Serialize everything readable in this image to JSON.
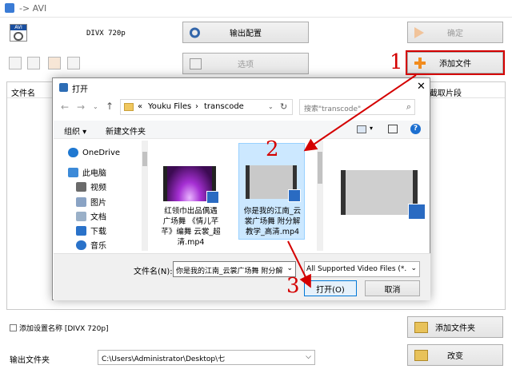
{
  "window": {
    "title": "-> AVI"
  },
  "main": {
    "profile_name": "DIVX 720p",
    "output_settings_label": "输出配置",
    "ok_label": "确定",
    "options_label": "选项",
    "add_file_label": "添加文件",
    "column_filename": "文件名",
    "column_clip": "截取片段",
    "add_setting_name_label": "添加设置名称 [DIVX 720p]",
    "add_folder_label": "添加文件夹",
    "output_folder_label": "输出文件夹",
    "output_folder_value": "C:\\Users\\Administrator\\Desktop\\七",
    "change_label": "改变"
  },
  "dialog": {
    "title": "打开",
    "breadcrumb": [
      "«",
      "Youku Files",
      "›",
      "transcode"
    ],
    "search_placeholder": "搜索\"transcode\"",
    "organize_label": "组织 ▾",
    "new_folder_label": "新建文件夹",
    "nav": [
      {
        "label": "OneDrive",
        "icon": "cloud-icon"
      },
      {
        "label": "此电脑",
        "icon": "computer-icon"
      },
      {
        "label": "视频",
        "icon": "video-folder-icon"
      },
      {
        "label": "图片",
        "icon": "picture-folder-icon"
      },
      {
        "label": "文档",
        "icon": "documents-folder-icon"
      },
      {
        "label": "下载",
        "icon": "download-icon"
      },
      {
        "label": "音乐",
        "icon": "music-icon"
      }
    ],
    "files": [
      {
        "name_lines": [
          "红领巾出品偶遇",
          "广场舞 《情儿芊",
          "芊》编舞 云裳_超",
          "清.mp4"
        ]
      },
      {
        "name_lines": [
          "你是我的江南_云",
          "裳广场舞 附分解",
          "教学_高清.mp4"
        ]
      },
      {
        "name_lines": []
      }
    ],
    "filename_label": "文件名(N):",
    "filename_value": "你是我的江南_云裳广场舞 附分解",
    "filter_value": "All Supported Video Files (*.",
    "open_label": "打开(O)",
    "cancel_label": "取消"
  },
  "annotations": {
    "step1": "1",
    "step2": "2",
    "step3": "3"
  },
  "colors": {
    "annotation": "#d40000",
    "selection": "#cce8ff",
    "link": "#1a5fb4"
  }
}
